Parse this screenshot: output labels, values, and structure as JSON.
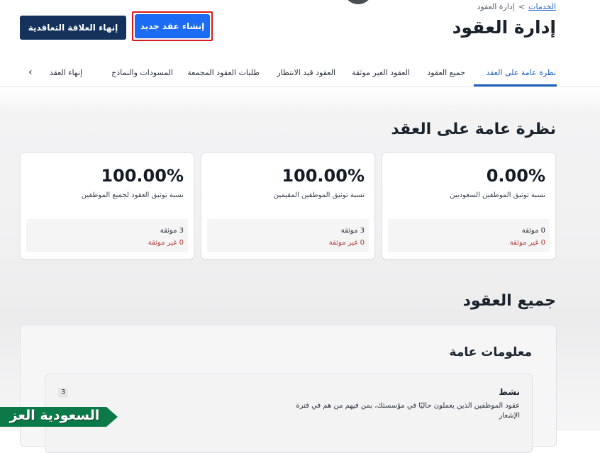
{
  "breadcrumb": {
    "home": "الخدمات",
    "separator": ">",
    "current": "إدارة العقود"
  },
  "page_title": "إدارة العقود",
  "actions": {
    "new_contract": "إنشاء عقد جديد",
    "end_relationship": "إنهاء العلاقة التعاقدية"
  },
  "tabs": [
    "نظرة عامة على العقد",
    "جميع العقود",
    "العقود الغير موثقة",
    "العقود قيد الانتظار",
    "طلبات العقود المجمعة",
    "المسودات والنماذج",
    "إنهاء العقد"
  ],
  "tab_arrow": "‹",
  "overview": {
    "title": "نظرة عامة على العقد",
    "cards": [
      {
        "percent": "0.00%",
        "label": "نسبة توثيق الموظفين السعوديين",
        "documented": "0 موثقة",
        "undocumented": "0 غير موثقة"
      },
      {
        "percent": "100.00%",
        "label": "نسبة توثيق الموظفين المقيمين",
        "documented": "3 موثقة",
        "undocumented": "0 غير موثقة"
      },
      {
        "percent": "100.00%",
        "label": "نسبة توثيق العقود لجميع الموظفين",
        "documented": "3 موثقة",
        "undocumented": "0 غير موثقة"
      }
    ]
  },
  "all_contracts": {
    "title": "جميع العقود",
    "general_info_title": "معلومات عامة",
    "active": {
      "title": "نشط",
      "count": "3",
      "description": "عقود الموظفين الذين يعملون حاليًا في مؤسستك، بمن فيهم من هم في فترة الإشعار"
    }
  },
  "watermark": "السعودية العز",
  "colors": {
    "primary": "#1b6bf5",
    "navy": "#14325c",
    "active_tab": "#1b5fb8",
    "highlight": "#d41c1c",
    "undocumented": "#b23a3a",
    "logo_green": "#0c7a48"
  }
}
